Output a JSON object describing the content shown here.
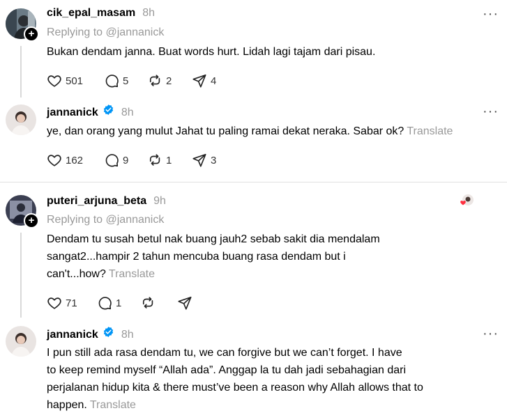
{
  "posts": [
    {
      "username": "cik_epal_masam",
      "time": "8h",
      "reply_label": "Replying to @jannanick",
      "text": "Bukan dendam janna. Buat words hurt. Lidah lagi tajam dari pisau.",
      "likes": "501",
      "replies": "5",
      "reposts": "2",
      "shares": "4"
    },
    {
      "username": "jannanick",
      "time": "8h",
      "text": "ye, dan orang yang mulut Jahat tu paling ramai dekat neraka. Sabar ok?",
      "translate": "Translate",
      "likes": "162",
      "replies": "9",
      "reposts": "1",
      "shares": "3"
    },
    {
      "username": "puteri_arjuna_beta",
      "time": "9h",
      "reply_label": "Replying to @jannanick",
      "text_lines": [
        "Dendam tu susah betul nak buang jauh2 sebab sakit dia mendalam",
        "sangat2...hampir 2 tahun mencuba buang rasa dendam but i",
        "can't...how?"
      ],
      "translate": "Translate",
      "likes": "71",
      "replies": "1"
    },
    {
      "username": "jannanick",
      "time": "8h",
      "text_lines": [
        "I pun still ada rasa dendam tu, we can forgive but we can’t forget. I have",
        "to keep remind myself “Allah ada”. Anggap la tu dah jadi sebahagian dari",
        "perjalanan hidup kita & there must’ve been a reason why Allah allows that to",
        "happen."
      ],
      "translate": "Translate"
    }
  ],
  "more_label": "···",
  "colors": {
    "verified": "#0095f6",
    "muted": "#999999",
    "liked_heart": "#ff3040"
  },
  "icons": [
    "heart-icon",
    "comment-icon",
    "repost-icon",
    "share-icon",
    "verified-icon",
    "more-icon",
    "follow-plus-icon"
  ]
}
